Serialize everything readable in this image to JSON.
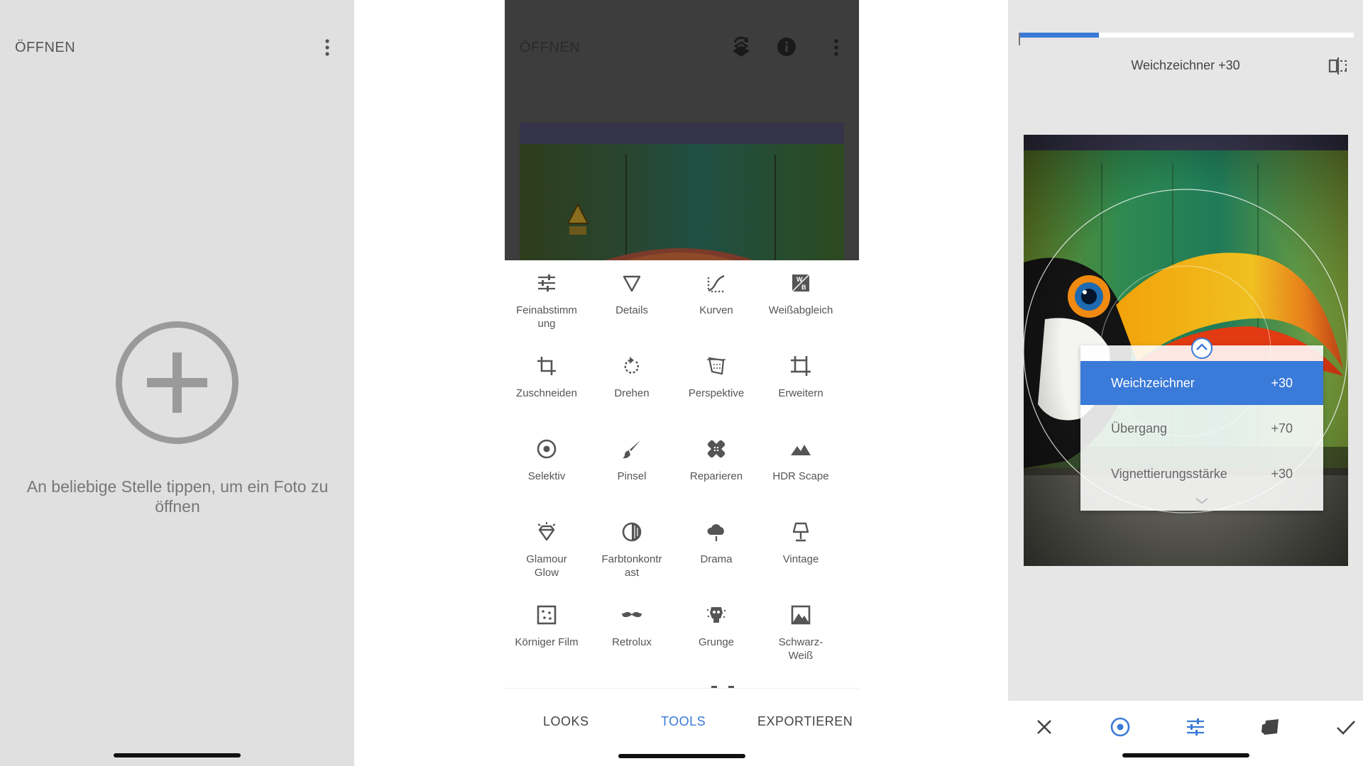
{
  "open_screen": {
    "title": "ÖFFNEN",
    "menu_icon": "more-vert-icon",
    "add_icon": "add-circle-icon",
    "hint": "An beliebige Stelle tippen, um ein Foto zu öffnen"
  },
  "editor": {
    "title": "ÖFFNEN",
    "icons": [
      "stack-history-icon",
      "info-icon",
      "more-vert-icon"
    ],
    "tools": [
      {
        "label": "Feinabstimmung",
        "icon": "tune-icon"
      },
      {
        "label": "Details",
        "icon": "triangle-details-icon"
      },
      {
        "label": "Kurven",
        "icon": "curves-icon"
      },
      {
        "label": "Weißabgleich",
        "icon": "white-balance-icon"
      },
      {
        "label": "Zuschneiden",
        "icon": "crop-icon"
      },
      {
        "label": "Drehen",
        "icon": "rotate-icon"
      },
      {
        "label": "Perspektive",
        "icon": "perspective-icon"
      },
      {
        "label": "Erweitern",
        "icon": "expand-icon"
      },
      {
        "label": "Selektiv",
        "icon": "selective-icon"
      },
      {
        "label": "Pinsel",
        "icon": "brush-icon"
      },
      {
        "label": "Reparieren",
        "icon": "healing-icon"
      },
      {
        "label": "HDR Scape",
        "icon": "mountain-icon"
      },
      {
        "label": "Glamour Glow",
        "icon": "diamond-icon"
      },
      {
        "label": "Farbtonkontrast",
        "icon": "tonal-contrast-icon"
      },
      {
        "label": "Drama",
        "icon": "cloud-icon"
      },
      {
        "label": "Vintage",
        "icon": "lamp-icon"
      },
      {
        "label": "Körniger Film",
        "icon": "grain-icon"
      },
      {
        "label": "Retrolux",
        "icon": "mustache-icon"
      },
      {
        "label": "Grunge",
        "icon": "grunge-icon"
      },
      {
        "label": "Schwarz-Weiß",
        "icon": "black-white-icon"
      }
    ],
    "tool_labels_wrapped": {
      "0": "Feinabstimm\nung",
      "12": "Glamour\nGlow",
      "13": "Farbtonkontr\nast",
      "19": "Schwarz-\nWeiß"
    },
    "tabs": {
      "looks": "LOOKS",
      "tools": "TOOLS",
      "export": "EXPORTIEREN"
    },
    "active_tab": "TOOLS"
  },
  "vignette_screen": {
    "adjustment_label": "Weichzeichner +30",
    "progress_fraction": 0.24,
    "compare_icon": "compare-icon",
    "params": [
      {
        "name": "Weichzeichner",
        "value": "+30",
        "selected": true
      },
      {
        "name": "Übergang",
        "value": "+70",
        "selected": false
      },
      {
        "name": "Vignettierungsstärke",
        "value": "+30",
        "selected": false
      }
    ],
    "bottom_icons": [
      "close-icon",
      "selective-point-icon",
      "tune-icon",
      "styles-icon",
      "check-icon"
    ]
  },
  "colors": {
    "accent": "#3a7ad8",
    "panel_gray": "#e0e0e0",
    "dark_overlay": "#3d3d3d"
  }
}
